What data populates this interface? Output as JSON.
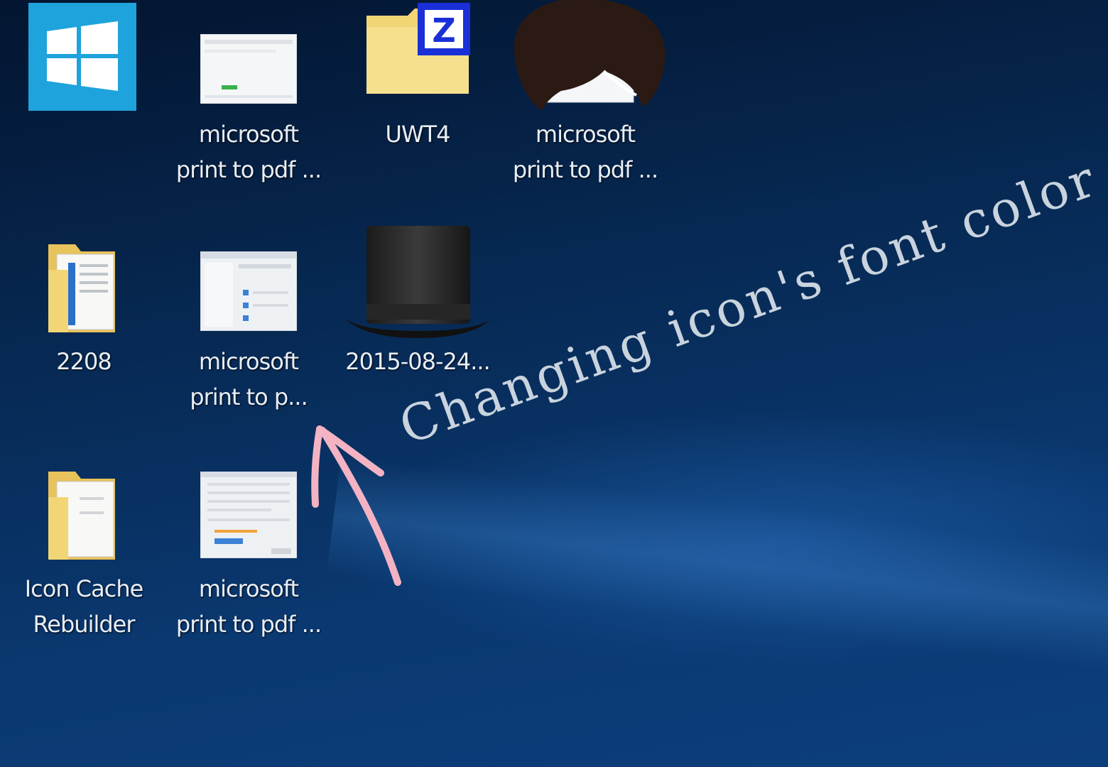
{
  "desktop": {
    "icons": [
      {
        "name": "windows",
        "label": "",
        "icon": "windows-logo-icon"
      },
      {
        "name": "pdf-1",
        "label": "microsoft\nprint to pdf ...",
        "icon": "document-thumbnail-icon"
      },
      {
        "name": "uwt4",
        "label": "UWT4",
        "icon": "zip-folder-icon"
      },
      {
        "name": "pdf-2",
        "label": "microsoft\nprint to pdf ...",
        "icon": "avatar-document-icon"
      },
      {
        "name": "folder-2208",
        "label": "2208",
        "icon": "folder-icon"
      },
      {
        "name": "pdf-3",
        "label": "microsoft\nprint to p...",
        "icon": "document-thumbnail-icon"
      },
      {
        "name": "date-file",
        "label": "2015-08-24...",
        "icon": "top-hat-icon"
      },
      {
        "name": "icon-cache-rebuilder",
        "label": "Icon Cache\nRebuilder",
        "icon": "folder-icon"
      },
      {
        "name": "pdf-4",
        "label": "microsoft\nprint to pdf ...",
        "icon": "document-thumbnail-icon"
      }
    ]
  },
  "annotation": {
    "text": "Changing icon's font color",
    "arrow_color": "#f3b3c3",
    "text_color": "#c9d3de"
  },
  "colors": {
    "desktop_background": "#072a55",
    "windows_tile": "#1fa3dc",
    "folder": "#f2d675"
  }
}
